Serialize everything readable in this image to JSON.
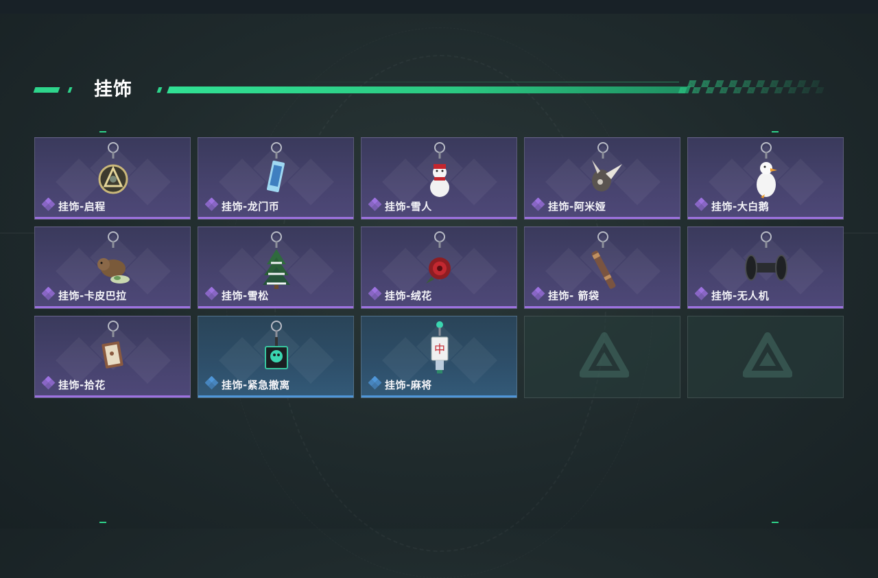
{
  "section": {
    "title": "挂饰"
  },
  "colors": {
    "accent_green": "#2ed58c",
    "rarity_purple": "#9d72e0",
    "rarity_blue": "#4f96d8"
  },
  "items": [
    {
      "name": "挂饰-启程",
      "rarity": "purple",
      "icon": "emblem-charm-icon"
    },
    {
      "name": "挂饰-龙门币",
      "rarity": "purple",
      "icon": "coin-tag-charm-icon"
    },
    {
      "name": "挂饰-雪人",
      "rarity": "purple",
      "icon": "snowman-charm-icon"
    },
    {
      "name": "挂饰-阿米娅",
      "rarity": "purple",
      "icon": "bunny-charm-icon"
    },
    {
      "name": "挂饰-大白鹅",
      "rarity": "purple",
      "icon": "goose-charm-icon"
    },
    {
      "name": "挂饰-卡皮巴拉",
      "rarity": "purple",
      "icon": "capybara-charm-icon"
    },
    {
      "name": "挂饰-雪松",
      "rarity": "purple",
      "icon": "pine-tree-charm-icon"
    },
    {
      "name": "挂饰-绒花",
      "rarity": "purple",
      "icon": "red-flower-charm-icon"
    },
    {
      "name": "挂饰- 箭袋",
      "rarity": "purple",
      "icon": "quiver-charm-icon"
    },
    {
      "name": "挂饰-无人机",
      "rarity": "purple",
      "icon": "drone-charm-icon"
    },
    {
      "name": "挂饰-拾花",
      "rarity": "purple",
      "icon": "frame-charm-icon"
    },
    {
      "name": "挂饰-紧急撤离",
      "rarity": "blue",
      "icon": "green-box-charm-icon"
    },
    {
      "name": "挂饰-麻将",
      "rarity": "blue",
      "icon": "mahjong-charm-icon"
    },
    {
      "name": "",
      "rarity": "empty",
      "icon": "placeholder-logo-icon"
    },
    {
      "name": "",
      "rarity": "empty",
      "icon": "placeholder-logo-icon"
    }
  ]
}
